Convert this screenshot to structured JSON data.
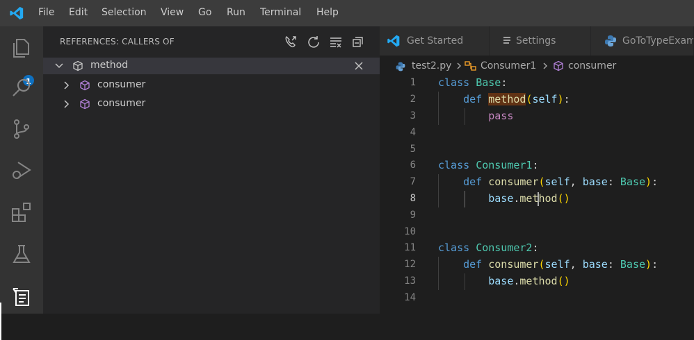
{
  "menu": [
    "File",
    "Edit",
    "Selection",
    "View",
    "Go",
    "Run",
    "Terminal",
    "Help"
  ],
  "activity": {
    "explorer_badge": "1"
  },
  "sidebar": {
    "title": "REFERENCES: CALLERS OF",
    "root": {
      "label": "method"
    },
    "items": [
      {
        "label": "consumer"
      },
      {
        "label": "consumer"
      }
    ]
  },
  "tabs": [
    {
      "label": "Get Started"
    },
    {
      "label": "Settings"
    },
    {
      "label": "GoToTypeExam"
    }
  ],
  "breadcrumbs": {
    "file": "test2.py",
    "class": "Consumer1",
    "method": "consumer"
  },
  "editor": {
    "line_numbers": [
      "1",
      "2",
      "3",
      "4",
      "5",
      "6",
      "7",
      "8",
      "9",
      "10",
      "11",
      "12",
      "13",
      "14"
    ],
    "current_line": "8",
    "lines": {
      "l1": {
        "kw": "class",
        "name": "Base",
        "punc": ":"
      },
      "l2": {
        "kw": "def",
        "fn": "method",
        "open": "(",
        "param": "self",
        "close": ")",
        "punc": ":"
      },
      "l3": {
        "kw": "pass"
      },
      "l6": {
        "kw": "class",
        "name": "Consumer1",
        "punc": ":"
      },
      "l7": {
        "kw": "def",
        "fn": "consumer",
        "open": "(",
        "p1": "self",
        "sep": ", ",
        "p2": "base",
        "colon": ": ",
        "type": "Base",
        "close": ")",
        "punc": ":"
      },
      "l8": {
        "obj": "base",
        "dot": ".",
        "fn_a": "me",
        "fn_b": "thod",
        "call": "()"
      },
      "l11": {
        "kw": "class",
        "name": "Consumer2",
        "punc": ":"
      },
      "l12": {
        "kw": "def",
        "fn": "consumer",
        "open": "(",
        "p1": "self",
        "sep": ", ",
        "p2": "base",
        "colon": ": ",
        "type": "Base",
        "close": ")",
        "punc": ":"
      },
      "l13": {
        "obj": "base",
        "dot": ".",
        "fn": "method",
        "call": "()"
      }
    }
  },
  "colors": {
    "keyword": "#569cd6",
    "class": "#4ec9b0",
    "function": "#dcdcaa",
    "parameter": "#9cdcfe",
    "control": "#c586c0",
    "bracket": "#ffd700",
    "symbol_icon": "#b180d7",
    "badge": "#0e70c0"
  }
}
